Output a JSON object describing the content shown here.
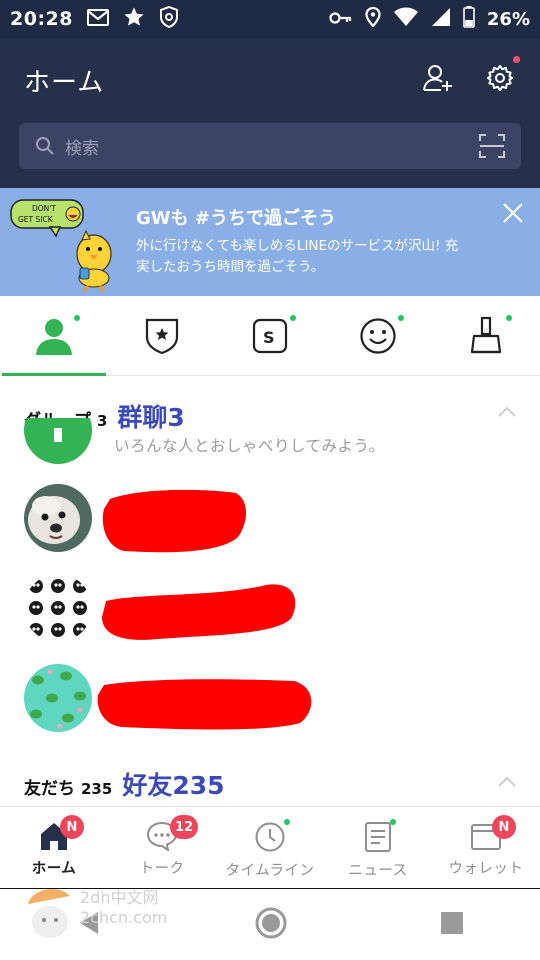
{
  "status_bar": {
    "time": "20:28",
    "battery": "26%"
  },
  "header": {
    "title": "ホーム",
    "search_placeholder": "検索"
  },
  "banner": {
    "mascot_text": "DON'T GET SICK",
    "title": "GWも #うちで過ごそう",
    "body": "外に行けなくても楽しめるLINEのサービスが沢山! 充実したおうち時間を過ごそう。"
  },
  "tabs": [
    {
      "icon": "friends-icon",
      "active": true
    },
    {
      "icon": "official-account-icon",
      "active": false
    },
    {
      "icon": "sticker-shop-icon",
      "active": false
    },
    {
      "icon": "emoji-icon",
      "active": false
    },
    {
      "icon": "theme-icon",
      "active": false
    }
  ],
  "groups": {
    "label": "グループ",
    "count": "3",
    "annotation": "群聊3",
    "hint": "いろんな人とおしゃべりしてみよう。"
  },
  "friends": {
    "label": "友だち",
    "count": "235",
    "annotation": "好友235"
  },
  "bottom_nav": [
    {
      "label": "ホーム",
      "badge": "N",
      "active": true
    },
    {
      "label": "トーク",
      "badge": "12",
      "active": false
    },
    {
      "label": "タイムライン",
      "badge": "",
      "active": false
    },
    {
      "label": "ニュース",
      "badge": "",
      "active": false
    },
    {
      "label": "ウォレット",
      "badge": "N",
      "active": false
    }
  ],
  "watermark": {
    "line1": "2dh中文网",
    "line2": "2chcn.com"
  },
  "colors": {
    "header_bg": "#27304b",
    "banner_bg": "#8aaee6",
    "accent_green": "#34b355",
    "badge_red": "#f0455a",
    "annotation_blue": "#3b4ab8",
    "redaction_red": "#ff0000"
  }
}
